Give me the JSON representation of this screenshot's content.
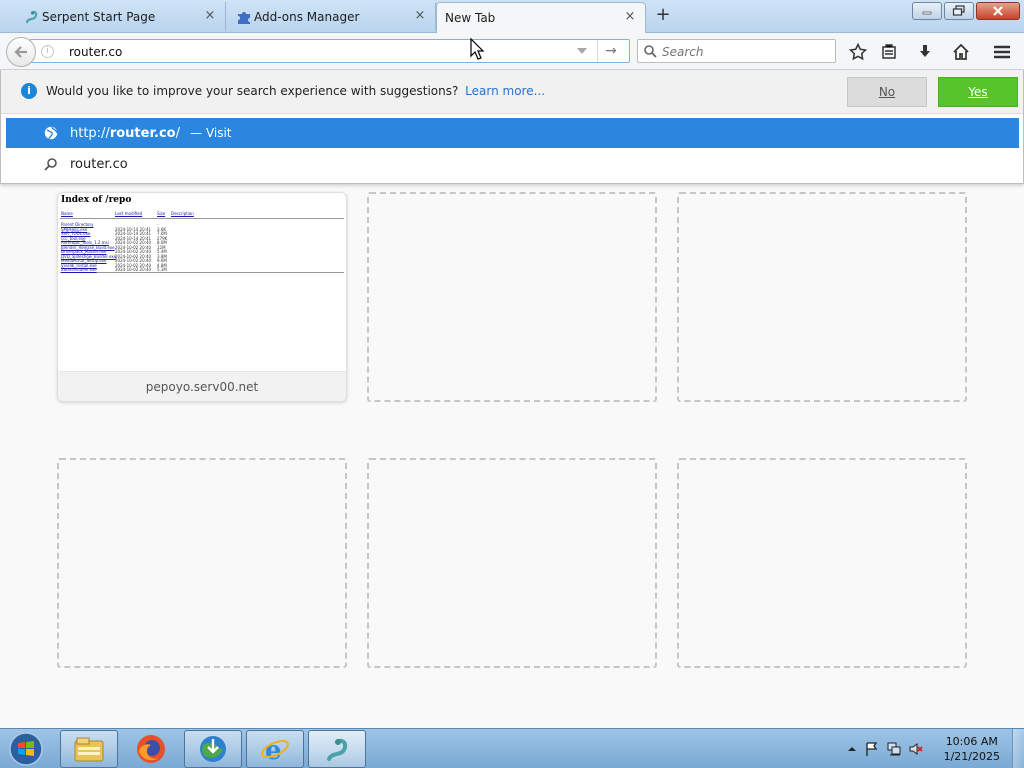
{
  "tabs": [
    {
      "title": "Serpent Start Page",
      "icon": "serpent-icon",
      "close": "×"
    },
    {
      "title": "Add-ons Manager",
      "icon": "puzzle-icon",
      "close": "×"
    },
    {
      "title": "New Tab",
      "active": true,
      "close": "×"
    }
  ],
  "new_tab_symbol": "+",
  "url_bar": {
    "value": "router.co",
    "go_symbol": "→"
  },
  "search_bar": {
    "placeholder": "Search"
  },
  "suggestion_notice": {
    "message": "Would you like to improve your search experience with suggestions?",
    "learn_more": "Learn more...",
    "no_label": "No",
    "yes_label": "Yes"
  },
  "autocomplete": [
    {
      "prefix": "http://",
      "bold": "router.co",
      "suffix": "/",
      "action": "— Visit",
      "icon": "globe-icon",
      "selected": true
    },
    {
      "text": "router.co",
      "icon": "search-icon",
      "selected": false
    }
  ],
  "tiles": [
    {
      "caption": "pepoyo.serv00.net",
      "thumbnail": {
        "title": "Index of /repo",
        "headers": [
          "Name",
          "Last modified",
          "Size",
          "Description"
        ],
        "entries": [
          [
            "Parent Directory",
            "",
            "-"
          ],
          [
            "SMBHelp.exe",
            "2024-10-14 20:41",
            "3.6K"
          ],
          [
            "SVR_TOOL.exe",
            "2024-10-14 20:41",
            "7.0M"
          ],
          [
            "ccc_tool.exe",
            "2024-10-14 20:41",
            "279K"
          ],
          [
            "Anthropic_Tools_1.2.msi",
            "2024-10-02 20:40",
            "8.0M"
          ],
          [
            "Blender_Release_Build.exe",
            "2024-10-02 20:40",
            "12M"
          ],
          [
            "Driverpack_Master.exe",
            "2024-10-02 20:40",
            "5.4M"
          ],
          [
            "DVD_Slideshow_Builder.exe",
            "2024-10-02 20:40",
            "3.8M"
          ],
          [
            "MediaPortal_Setup.exe",
            "2024-10-02 20:40",
            "9.6M"
          ],
          [
            "Vivaldi_Install.exe",
            "2024-10-02 20:40",
            "4.8M"
          ],
          [
            "ZoomInstaller.exe",
            "2024-10-02 20:40",
            "5.1M"
          ]
        ]
      }
    },
    {
      "caption": ""
    },
    {
      "caption": ""
    },
    {
      "caption": ""
    },
    {
      "caption": ""
    },
    {
      "caption": ""
    }
  ],
  "taskbar": {
    "apps": [
      "file-explorer-icon",
      "firefox-icon",
      "download-manager-icon",
      "internet-explorer-icon",
      "serpent-browser-icon"
    ],
    "clock_time": "10:06 AM",
    "clock_date": "1/21/2025"
  },
  "colors": {
    "accent": "#2a86df",
    "yes_button": "#56c42a",
    "info": "#1b86d7"
  }
}
